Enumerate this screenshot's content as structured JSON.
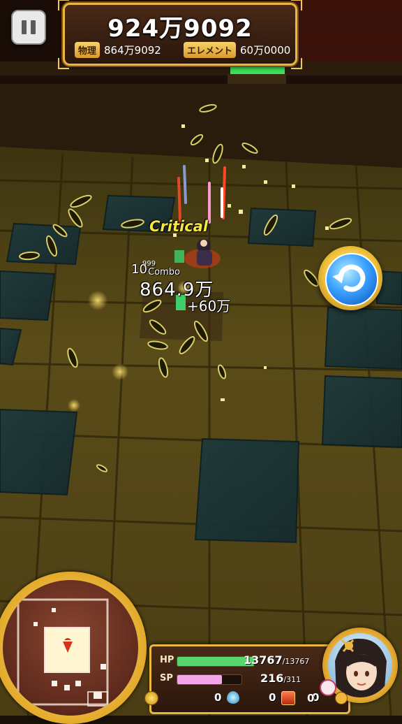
{
  "score": {
    "total": "924万9092",
    "physical_label": "物理",
    "physical_value": "864万9092",
    "element_label": "エレメント",
    "element_value": "60万0000"
  },
  "battle_text": {
    "critical": "Critical",
    "combo_number": "10",
    "combo_label": "Combo",
    "small_number": "999",
    "damage": "864.9万",
    "damage_bonus": "+60万"
  },
  "status": {
    "hp_label": "HP",
    "hp_value": "13767",
    "hp_max": "/13767",
    "hp_fraction": 1.0,
    "sp_label": "SP",
    "sp_value": "216",
    "sp_max": "/311",
    "sp_fraction": 0.695,
    "coins": "0",
    "drops": "0",
    "chests": "0",
    "other": "0"
  },
  "colors": {
    "gold": "#e9b641",
    "hp_bar": "#56d66b",
    "sp_bar": "#f2a6e8",
    "critical_text": "#f5e640"
  },
  "icons": [
    "pause-icon",
    "rotate-icon",
    "coin-icon",
    "drop-icon",
    "chest-icon",
    "item-icon"
  ]
}
